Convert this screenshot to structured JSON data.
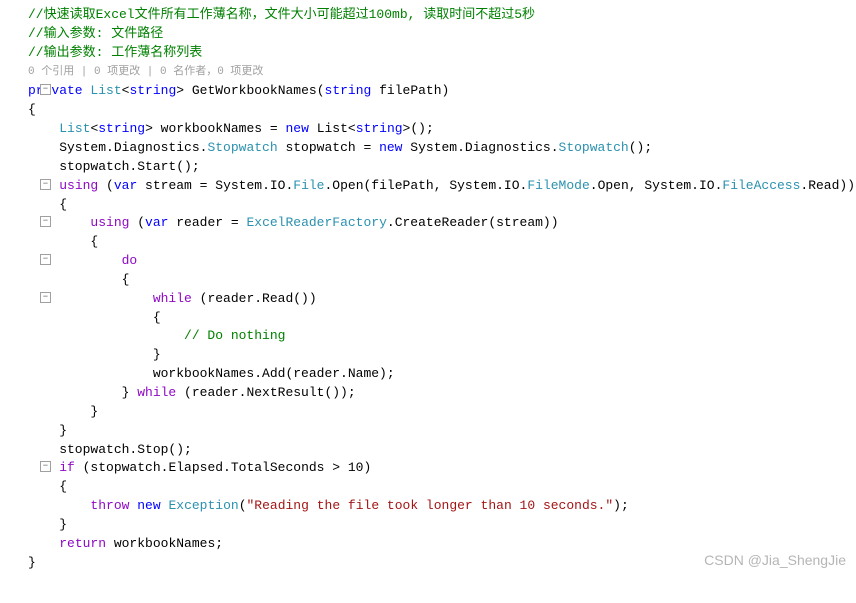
{
  "codelens": "0 个引用 | 0 项更改 | 0 名作者，0 项更改",
  "watermark": "CSDN @Jia_ShengJie",
  "code": {
    "c1": "//快速读取Excel文件所有工作薄名称，文件大小可能超过100mb, 读取时间不超过5秒",
    "c2": "//输入参数: 文件路径",
    "c3": "//输出参数: 工作薄名称列表",
    "sig_private": "private",
    "sig_list": "List",
    "sig_string1": "string",
    "sig_method": " GetWorkbookNames(",
    "sig_string2": "string",
    "sig_param": " filePath)",
    "l_open1": "{",
    "l6a": "List",
    "l6b": "string",
    "l6c": "> workbookNames = ",
    "l6d": "new",
    "l6e": " List",
    "l6f": "string",
    "l6g": ">();",
    "l7a": "    System.Diagnostics.",
    "l7b": "Stopwatch",
    "l7c": " stopwatch = ",
    "l7d": "new",
    "l7e": " System.Diagnostics.",
    "l7f": "Stopwatch",
    "l7g": "();",
    "l8": "    stopwatch.Start();",
    "l9a": "using",
    "l9b": " (",
    "l9c": "var",
    "l9d": " stream = System.IO.",
    "l9e": "File",
    "l9f": ".Open(filePath, System.IO.",
    "l9g": "FileMode",
    "l9h": ".Open, System.IO.",
    "l9i": "FileAccess",
    "l9j": ".Read))",
    "l10": "    {",
    "l11a": "using",
    "l11b": " (",
    "l11c": "var",
    "l11d": " reader = ",
    "l11e": "ExcelReaderFactory",
    "l11f": ".CreateReader(stream))",
    "l12": "        {",
    "l13": "do",
    "l14": "            {",
    "l15a": "while",
    "l15b": " (reader.Read())",
    "l16": "                {",
    "l17": "                    // Do nothing",
    "l18": "                }",
    "l19": "                workbookNames.Add(reader.Name);",
    "l20a": "            } ",
    "l20b": "while",
    "l20c": " (reader.NextResult());",
    "l21": "        }",
    "l22": "    }",
    "l23": "    stopwatch.Stop();",
    "l24a": "if",
    "l24b": " (stopwatch.Elapsed.TotalSeconds > 10)",
    "l25": "    {",
    "l26a": "throw",
    "l26b": "new",
    "l26c": "Exception",
    "l26d": "\"Reading the file took longer than 10 seconds.\"",
    "l26e": ";",
    "l27": "    }",
    "l28a": "return",
    "l28b": " workbookNames;",
    "l29": "}"
  }
}
